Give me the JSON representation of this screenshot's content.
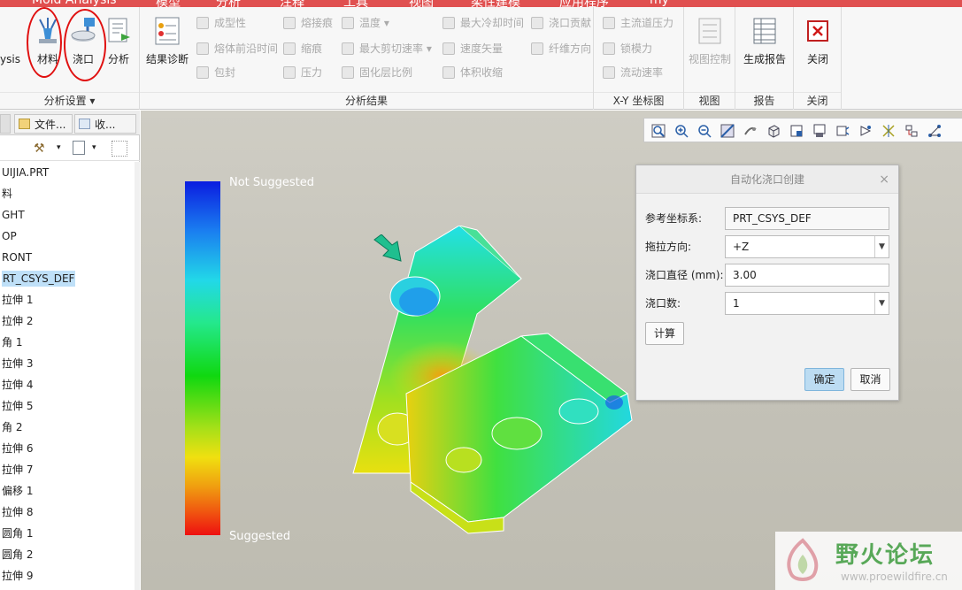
{
  "ribbon": {
    "tabs": [
      "Mold Analysis",
      "模型",
      "分析",
      "注释",
      "工具",
      "视图",
      "柔性建模",
      "应用程序",
      "my"
    ],
    "groups": {
      "analysis_setup": {
        "label": "分析设置",
        "partial_left_label": "ysis",
        "buttons": [
          {
            "label": "材料",
            "icon": "material-icon"
          },
          {
            "label": "浇口",
            "icon": "gate-icon"
          },
          {
            "label": "分析",
            "icon": "analysis-flag-icon"
          }
        ]
      },
      "analysis_results": {
        "label": "分析结果",
        "diagnose_label": "结果诊断",
        "col1": [
          "成型性",
          "熔体前沿时间",
          "包封"
        ],
        "col2": [
          "熔接痕",
          "缩痕",
          "压力"
        ],
        "col3": [
          "温度",
          "最大剪切速率",
          "固化层比例"
        ],
        "col4": [
          "最大冷却时间",
          "速度矢量",
          "体积收缩"
        ],
        "col5": [
          "浇口贡献",
          "纤维方向"
        ]
      },
      "xy": {
        "label": "X-Y 坐标图",
        "items": [
          "主流道压力",
          "锁模力",
          "流动速率"
        ]
      },
      "view": {
        "label": "视图",
        "button": "视图控制"
      },
      "report": {
        "label": "报告",
        "button": "生成报告"
      },
      "close": {
        "label": "关闭",
        "button": "关闭"
      }
    }
  },
  "left_panel": {
    "tabs": [
      "文件...",
      "收..."
    ],
    "tree": [
      "UIJIA.PRT",
      "料",
      "GHT",
      "OP",
      "RONT",
      "RT_CSYS_DEF",
      "拉伸 1",
      "拉伸 2",
      "角 1",
      "拉伸 3",
      "拉伸 4",
      "拉伸 5",
      "角 2",
      "拉伸 6",
      "拉伸 7",
      "偏移 1",
      "拉伸 8",
      "圆角 1",
      "圆角 2",
      "拉伸 9"
    ],
    "selected_index": 5
  },
  "legend": {
    "top": "Not Suggested",
    "bottom": "Suggested"
  },
  "dialog": {
    "title": "自动化浇口创建",
    "close": "×",
    "fields": {
      "ref_csys": {
        "label": "参考坐标系:",
        "value": "PRT_CSYS_DEF"
      },
      "pull_dir": {
        "label": "拖拉方向:",
        "value": "+Z"
      },
      "gate_dia": {
        "label": "浇口直径 (mm):",
        "value": "3.00"
      },
      "gate_count": {
        "label": "浇口数:",
        "value": "1"
      }
    },
    "calc": "计算",
    "ok": "确定",
    "cancel": "取消"
  },
  "watermark": {
    "brand": "野火论坛",
    "url": "www.proewildfire.cn"
  }
}
